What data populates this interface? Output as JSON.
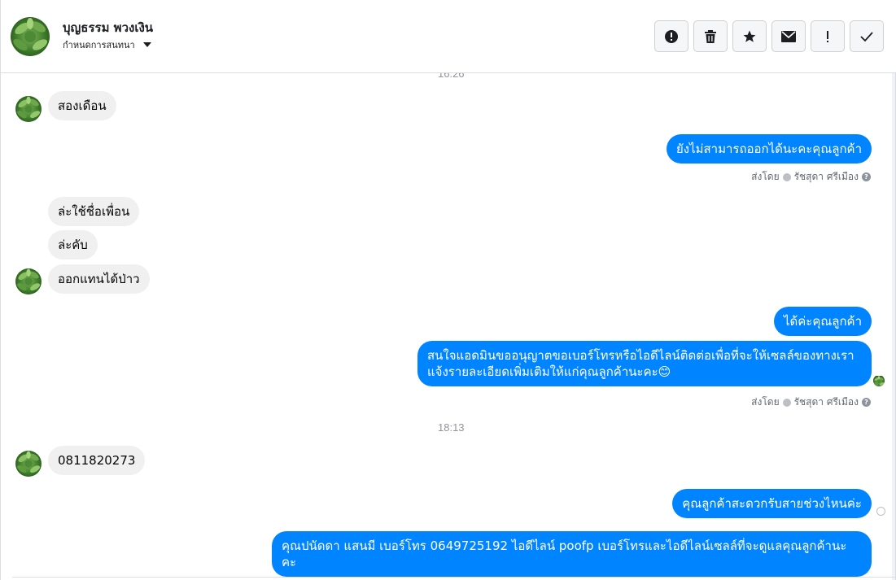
{
  "header": {
    "contact_name": "บุญธรรม พวงเงิน",
    "assign_label": "กำหนดการสนทนา",
    "actions": [
      {
        "name": "report-spam-button",
        "icon": "alert-circle-icon"
      },
      {
        "name": "delete-button",
        "icon": "trash-icon"
      },
      {
        "name": "star-button",
        "icon": "star-icon"
      },
      {
        "name": "mark-unread-button",
        "icon": "envelope-icon"
      },
      {
        "name": "flag-button",
        "icon": "exclamation-icon"
      },
      {
        "name": "mark-done-button",
        "icon": "check-icon"
      }
    ]
  },
  "messages": {
    "ts1": "16:26",
    "m1": "สองเดือน",
    "m2": "ยังไม่สามารถออกได้นะคะคุณลูกค้า",
    "sentby_label": "ส่งโดย",
    "agent_name": "รัชสุดา ศรีเมือง",
    "m3": "ล่ะใช้ชื่อเพื่อน",
    "m4": "ล่ะคับ",
    "m5": "ออกแทนได้ป่าว",
    "m6": "ได้ค่ะคุณลูกค้า",
    "m7_line1": "สนใจแอดมินขออนุญาตขอเบอร์โทรหรือไอดีไลน์ติดต่อเพื่อที่จะให้เซลล์ของทางเรา",
    "m7_line2": "แจ้งรายละเอียดเพิ่มเติมให้แก่คุณลูกค้านะคะ😊",
    "ts2": "18:13",
    "m8": "0811820273",
    "m9": "คุณลูกค้าสะดวกรับสายช่วงไหนค่ะ",
    "m10_line1": "คุณปนัดดา แสนมี   เบอร์โทร 0649725192  ไอดีไลน์ poofp   เบอร์โทรและไอดีไลน์เซลล์ที่จะดูแลคุณลูกค้านะ",
    "m10_line2": "คะ"
  },
  "colors": {
    "outgoing": "#0084ff",
    "incoming": "#f0f0f0",
    "avatar_green": "#3f7d2c"
  }
}
